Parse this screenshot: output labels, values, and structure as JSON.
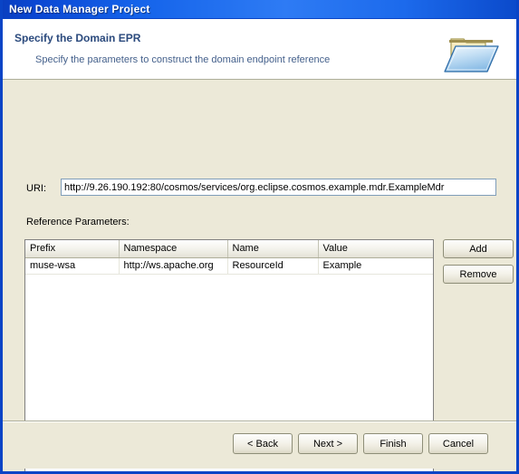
{
  "window": {
    "title": "New Data Manager Project"
  },
  "header": {
    "title": "Specify the Domain EPR",
    "subtitle": "Specify the parameters to construct the domain endpoint reference",
    "icon": "open-folder-icon"
  },
  "form": {
    "uri_label": "URI:",
    "uri_value": "http://9.26.190.192:80/cosmos/services/org.eclipse.cosmos.example.mdr.ExampleMdr",
    "uri_placeholder": "",
    "section_label": "Reference Parameters:"
  },
  "table": {
    "columns": [
      "Prefix",
      "Namespace",
      "Name",
      "Value"
    ],
    "rows": [
      {
        "prefix": "muse-wsa",
        "namespace": "http://ws.apache.org",
        "name": "ResourceId",
        "value": "Example"
      }
    ]
  },
  "side_buttons": {
    "add": "Add",
    "remove": "Remove"
  },
  "footer_buttons": {
    "back": "< Back",
    "next": "Next >",
    "finish": "Finish",
    "cancel": "Cancel"
  },
  "colors": {
    "title_bar_blue": "#0A44C6",
    "dialog_background": "#ECE9D8",
    "header_title": "#2B4A7D",
    "header_subtitle": "#45618C",
    "field_border": "#7F9DB9"
  }
}
